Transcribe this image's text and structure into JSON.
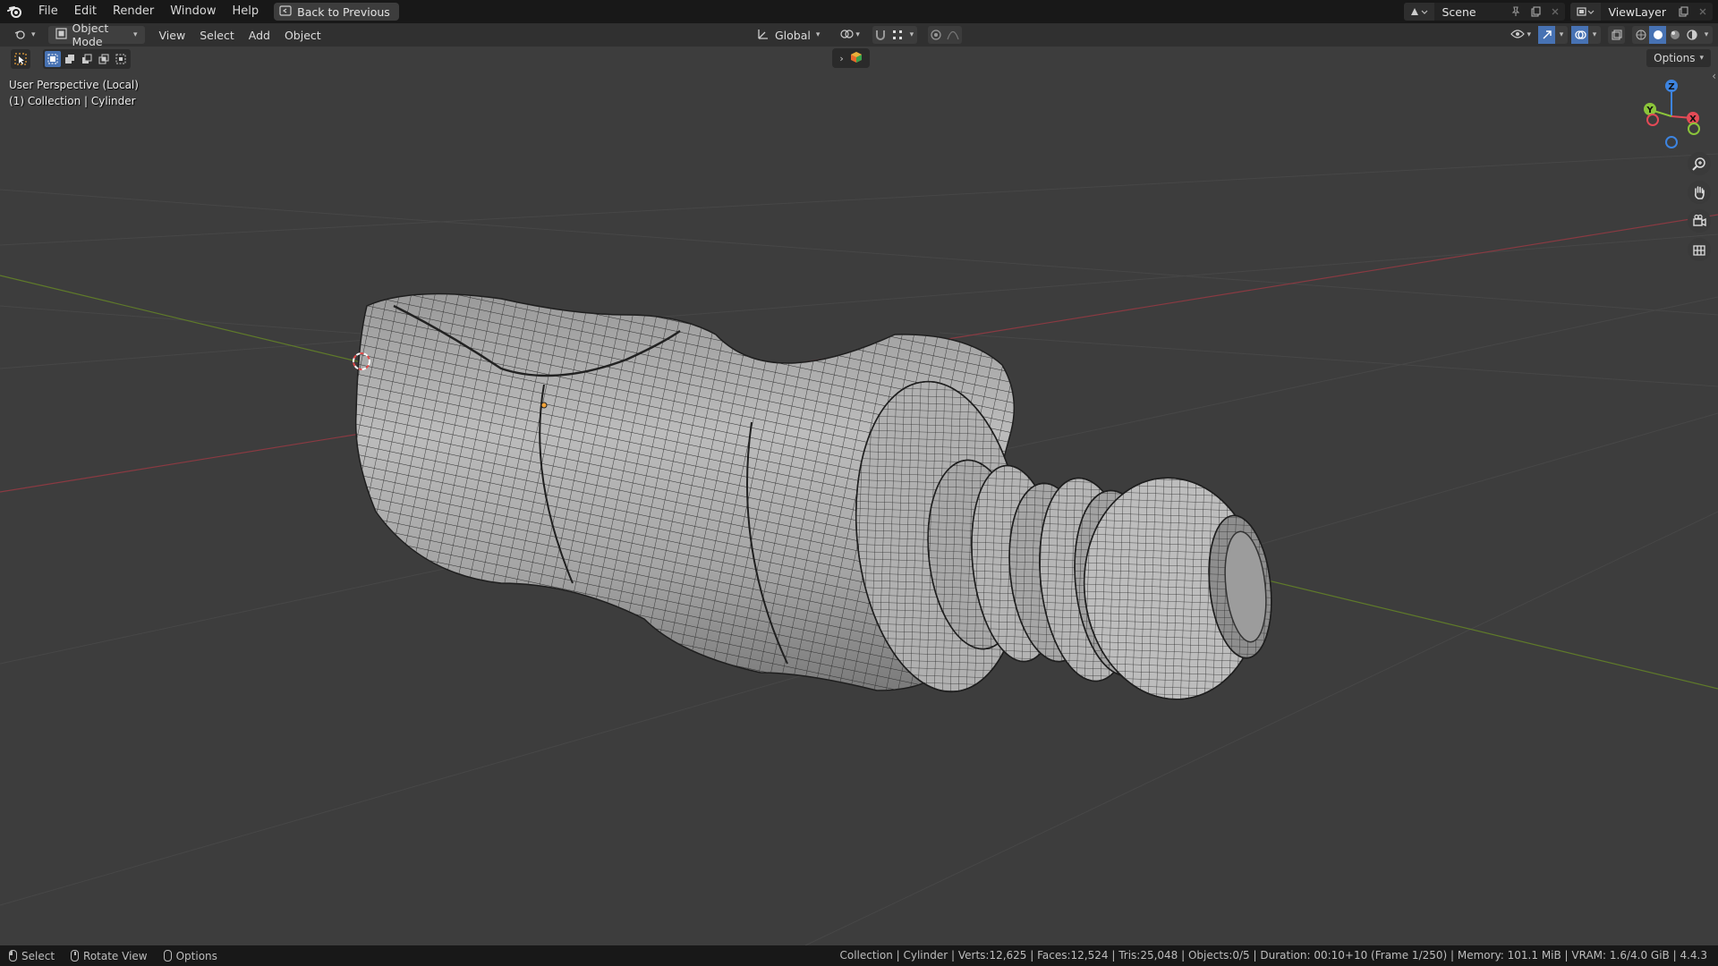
{
  "menubar": {
    "items": [
      "File",
      "Edit",
      "Render",
      "Window",
      "Help"
    ],
    "back_button": "Back to Previous"
  },
  "scene": {
    "name": "Scene"
  },
  "viewlayer": {
    "name": "ViewLayer"
  },
  "viewport_header": {
    "mode": "Object Mode",
    "menus": [
      "View",
      "Select",
      "Add",
      "Object"
    ],
    "transform_orientation": "Global",
    "options_label": "Options"
  },
  "viewport": {
    "perspective_label": "User Perspective (Local)",
    "collection_label": "(1) Collection | Cylinder",
    "active_object": "Cylinder",
    "gizmo": {
      "x": "X",
      "y": "Y",
      "z": "Z"
    }
  },
  "statusbar": {
    "select": "Select",
    "rotate": "Rotate View",
    "options": "Options",
    "stats": "Collection | Cylinder | Verts:12,625 | Faces:12,524 | Tris:25,048 | Objects:0/5 | Duration: 00:10+10 (Frame 1/250) | Memory: 101.1 MiB | VRAM: 1.6/4.0 GiB | 4.4.3"
  },
  "colors": {
    "accent": "#4772b3",
    "axis_x": "#a3424a",
    "axis_y": "#6a8a2a",
    "gizmo_x": "#e44a56",
    "gizmo_y": "#8bc43a",
    "gizmo_z": "#3d84e0",
    "viewport_bg": "#3d3d3d"
  },
  "icons": [
    "blender-logo-icon",
    "back-icon",
    "editor-type-icon",
    "object-mode-icon",
    "transform-orientation-icon",
    "pivot-icon",
    "snap-icon",
    "proportional-edit-icon",
    "visibility-icon",
    "gizmo-icon",
    "overlay-icon",
    "xray-icon",
    "wireframe-shading-icon",
    "solid-shading-icon",
    "material-shading-icon",
    "rendered-shading-icon",
    "zoom-icon",
    "pan-hand-icon",
    "camera-icon",
    "grid-icon"
  ]
}
